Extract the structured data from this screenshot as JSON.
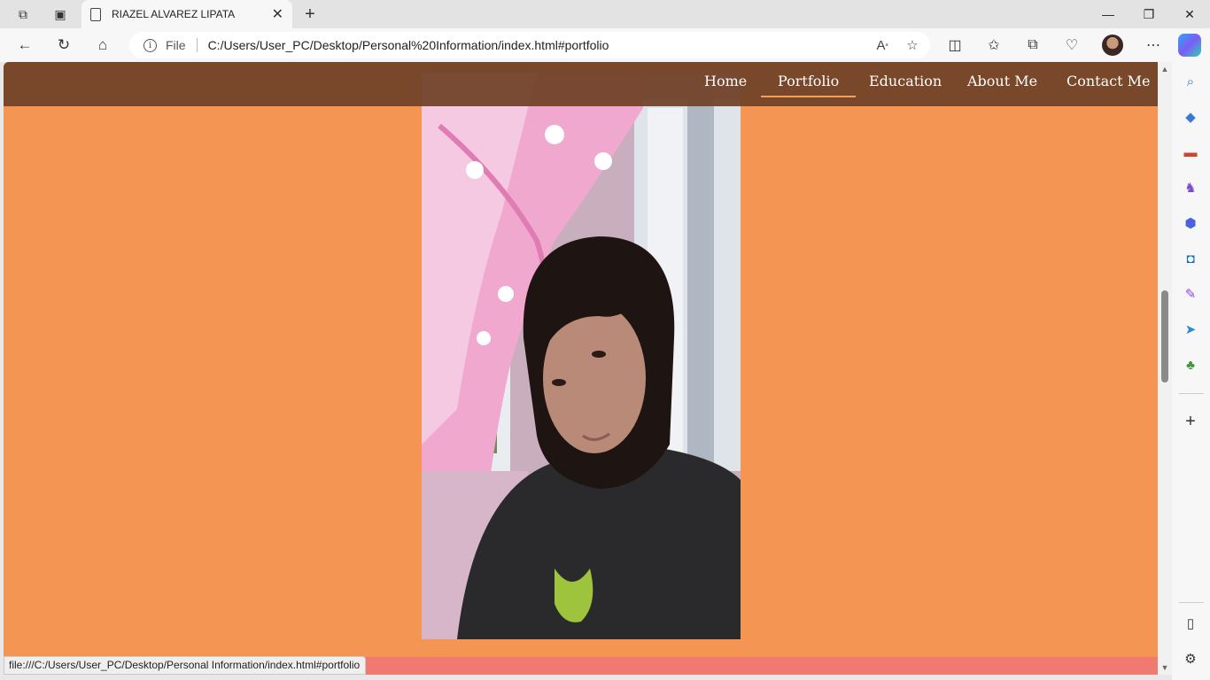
{
  "browser": {
    "tab_title": "RIAZEL ALVAREZ LIPATA",
    "new_tab_icon": "+",
    "address_scheme": "File",
    "address_url": "C:/Users/User_PC/Desktop/Personal%20Information/index.html#portfolio",
    "status_url": "file:///C:/Users/User_PC/Desktop/Personal Information/index.html#portfolio"
  },
  "site": {
    "nav": [
      {
        "label": "Home",
        "active": false
      },
      {
        "label": "Portfolio",
        "active": true
      },
      {
        "label": "Education",
        "active": false
      },
      {
        "label": "About Me",
        "active": false
      },
      {
        "label": "Contact Me",
        "active": false
      }
    ],
    "colors": {
      "page_background": "#f59553",
      "nav_background": "#6e4026",
      "active_underline": "#f0a15a",
      "bottom_band": "#f07a70"
    }
  },
  "icons": {
    "sidebar": [
      "search-icon",
      "tag-icon",
      "briefcase-icon",
      "chess-icon",
      "copilot-icon",
      "outlook-icon",
      "pen-icon",
      "send-icon",
      "tree-icon",
      "add-icon",
      "panel-icon",
      "settings-icon"
    ]
  }
}
